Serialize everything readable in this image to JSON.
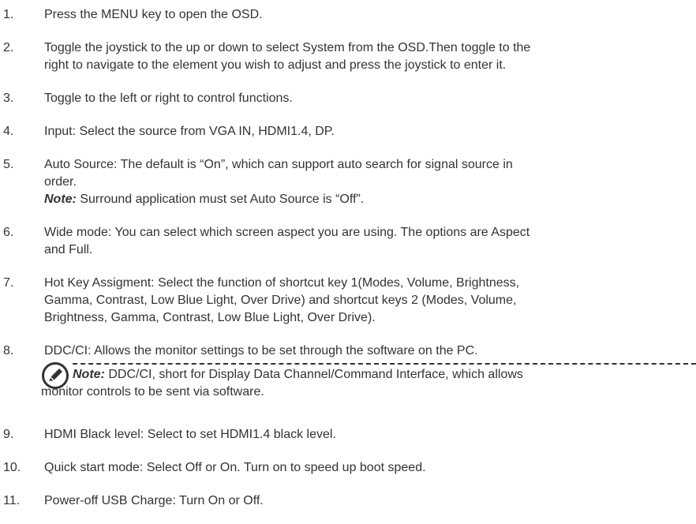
{
  "items": [
    {
      "num": "1.",
      "text": "Press the MENU key to open the OSD."
    },
    {
      "num": "2.",
      "line1": "Toggle the joystick to the up or down to select System from the OSD.Then toggle to the",
      "line2": "right to navigate to the element you wish to adjust and press the joystick to enter it."
    },
    {
      "num": "3.",
      "text": "Toggle to the left or right to control functions."
    },
    {
      "num": "4.",
      "text": "Input: Select the source from VGA IN, HDMI1.4, DP."
    },
    {
      "num": "5.",
      "line1": "Auto Source: The default is “On”, which can support auto search for signal source in",
      "line2": "order.",
      "note_label": "Note:",
      "note_text": " Surround application must set Auto Source is “Off”."
    },
    {
      "num": "6.",
      "line1": "Wide mode: You can select which screen aspect you are using. The options are Aspect",
      "line2": "and Full."
    },
    {
      "num": "7.",
      "line1": "Hot Key Assigment: Select the function of shortcut key 1(Modes, Volume, Brightness,",
      "line2": "Gamma, Contrast, Low Blue Light, Over Drive) and shortcut keys 2 (Modes, Volume,",
      "line3": "Brightness, Gamma, Contrast, Low Blue Light, Over Drive)."
    },
    {
      "num": "8.",
      "text": "DDC/CI: Allows the monitor settings to be set through the software on the PC."
    },
    {
      "num": "9.",
      "text": "HDMI Black level: Select to set HDMI1.4 black level."
    },
    {
      "num": "10.",
      "text": "Quick start mode: Select Off or On. Turn on to speed up boot speed."
    },
    {
      "num": "11.",
      "text": "Power-off USB Charge: Turn On or Off."
    }
  ],
  "callout": {
    "icon": "note-pencil-icon",
    "label": "Note:",
    "line1": " DDC/CI, short for Display Data Channel/Command Interface, which allows",
    "line2": "monitor controls to be sent via software."
  },
  "colors": {
    "text": "#333333"
  }
}
